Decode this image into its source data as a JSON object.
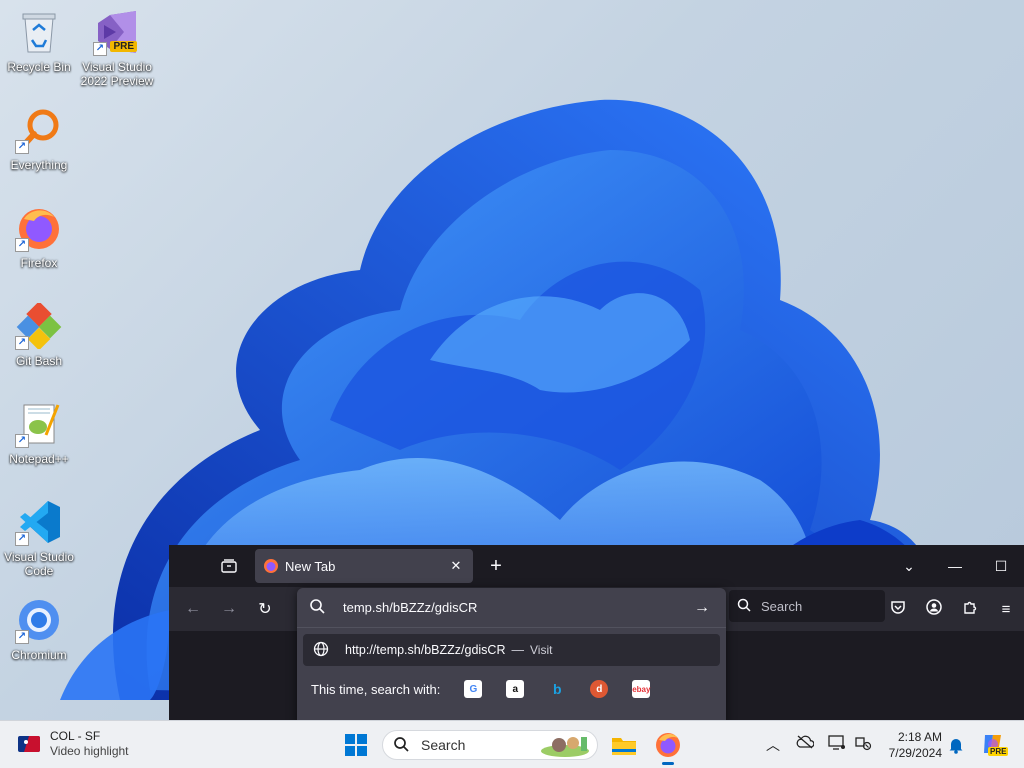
{
  "desktop": {
    "icons": [
      {
        "label": "Recycle Bin",
        "icon": "recycle-bin-icon"
      },
      {
        "label": "Visual Studio 2022 Preview",
        "icon": "visual-studio-preview-icon",
        "badge": "PRE"
      },
      {
        "label": "Everything",
        "icon": "everything-search-icon"
      },
      {
        "label": "Firefox",
        "icon": "firefox-icon"
      },
      {
        "label": "Git Bash",
        "icon": "git-bash-icon"
      },
      {
        "label": "Notepad++",
        "icon": "notepad-plus-plus-icon"
      },
      {
        "label": "Visual Studio Code",
        "icon": "vscode-icon"
      },
      {
        "label": "Chromium",
        "icon": "chromium-icon"
      }
    ]
  },
  "browser": {
    "tab_title": "New Tab",
    "url_input": "temp.sh/bBZZz/gdisCR",
    "suggestion_url": "http://temp.sh/bBZZz/gdisCR",
    "suggestion_sep": "—",
    "suggestion_action": "Visit",
    "search_with_label": "This time, search with:",
    "search_placeholder": "Search",
    "engines": [
      "google",
      "amazon",
      "bing",
      "duckduckgo",
      "ebay"
    ]
  },
  "taskbar": {
    "widget_title": "COL - SF",
    "widget_subtitle": "Video highlight",
    "search_label": "Search",
    "time": "2:18 AM",
    "date": "7/29/2024",
    "copilot_badge": "PRE"
  },
  "colors": {
    "browser_bg": "#1c1b22",
    "browser_toolbar": "#2b2a33",
    "accent": "#0067c0"
  }
}
